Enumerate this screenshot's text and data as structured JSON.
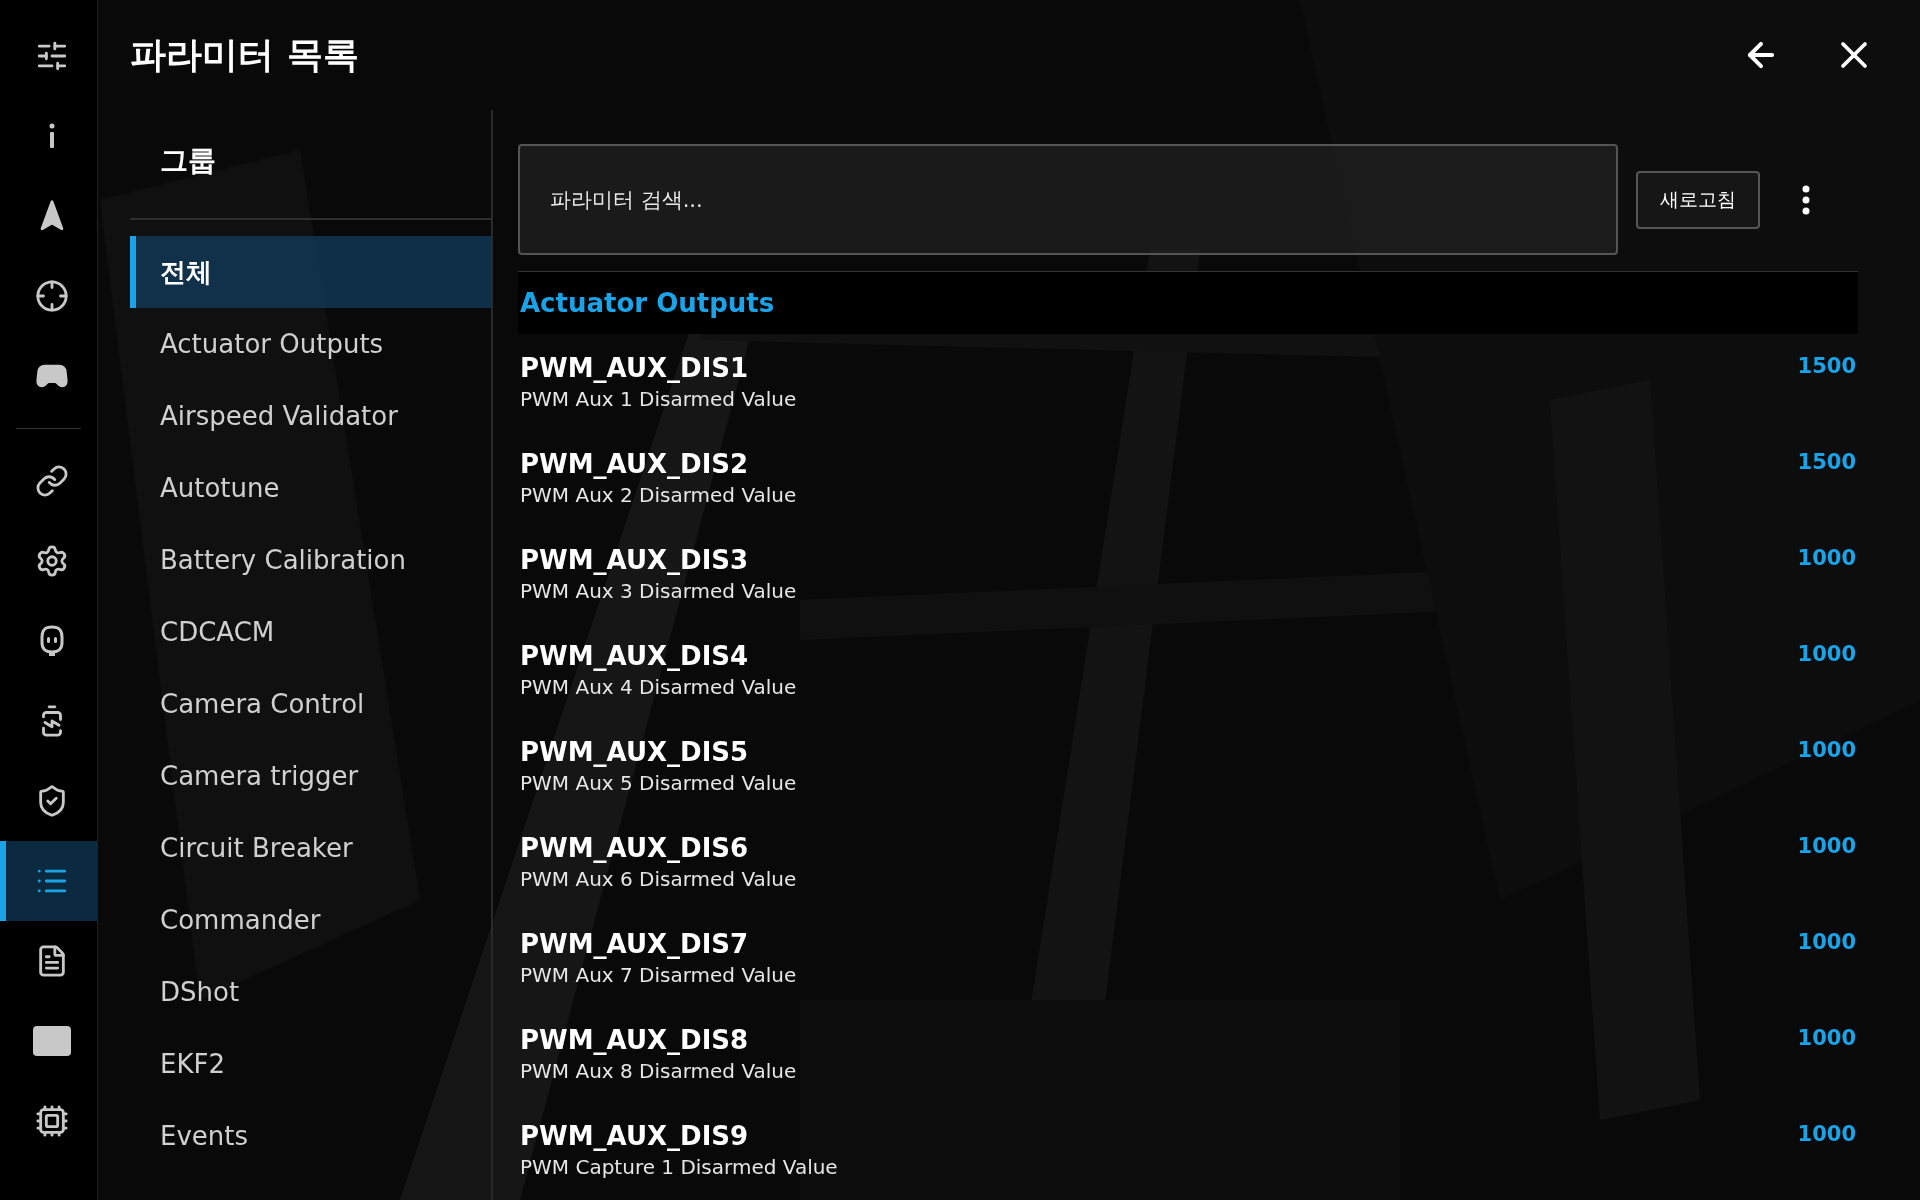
{
  "header": {
    "title": "파라미터 목록"
  },
  "rail_items": [
    {
      "selected": false
    },
    {
      "selected": false
    },
    {
      "selected": false
    },
    {
      "selected": false
    },
    {
      "selected": false
    },
    {
      "selected": false
    },
    {
      "selected": false
    },
    {
      "selected": false
    },
    {
      "selected": false
    },
    {
      "selected": false
    },
    {
      "selected": true
    },
    {
      "selected": false
    },
    {
      "selected": false
    },
    {
      "selected": false
    }
  ],
  "groups": {
    "title": "그룹",
    "items": [
      {
        "label": "전체",
        "selected": true
      },
      {
        "label": "Actuator Outputs",
        "selected": false
      },
      {
        "label": "Airspeed Validator",
        "selected": false
      },
      {
        "label": "Autotune",
        "selected": false
      },
      {
        "label": "Battery Calibration",
        "selected": false
      },
      {
        "label": "CDCACM",
        "selected": false
      },
      {
        "label": "Camera Control",
        "selected": false
      },
      {
        "label": "Camera trigger",
        "selected": false
      },
      {
        "label": "Circuit Breaker",
        "selected": false
      },
      {
        "label": "Commander",
        "selected": false
      },
      {
        "label": "DShot",
        "selected": false
      },
      {
        "label": "EKF2",
        "selected": false
      },
      {
        "label": "Events",
        "selected": false
      }
    ]
  },
  "search": {
    "placeholder": "파라미터 검색..."
  },
  "refresh_button": "새로고침",
  "section": "Actuator Outputs",
  "params": [
    {
      "name": "PWM_AUX_DIS1",
      "description": "PWM Aux 1 Disarmed Value",
      "value": "1500"
    },
    {
      "name": "PWM_AUX_DIS2",
      "description": "PWM Aux 2 Disarmed Value",
      "value": "1500"
    },
    {
      "name": "PWM_AUX_DIS3",
      "description": "PWM Aux 3 Disarmed Value",
      "value": "1000"
    },
    {
      "name": "PWM_AUX_DIS4",
      "description": "PWM Aux 4 Disarmed Value",
      "value": "1000"
    },
    {
      "name": "PWM_AUX_DIS5",
      "description": "PWM Aux 5 Disarmed Value",
      "value": "1000"
    },
    {
      "name": "PWM_AUX_DIS6",
      "description": "PWM Aux 6 Disarmed Value",
      "value": "1000"
    },
    {
      "name": "PWM_AUX_DIS7",
      "description": "PWM Aux 7 Disarmed Value",
      "value": "1000"
    },
    {
      "name": "PWM_AUX_DIS8",
      "description": "PWM Aux 8 Disarmed Value",
      "value": "1000"
    },
    {
      "name": "PWM_AUX_DIS9",
      "description": "PWM Capture 1 Disarmed Value",
      "value": "1000"
    }
  ]
}
